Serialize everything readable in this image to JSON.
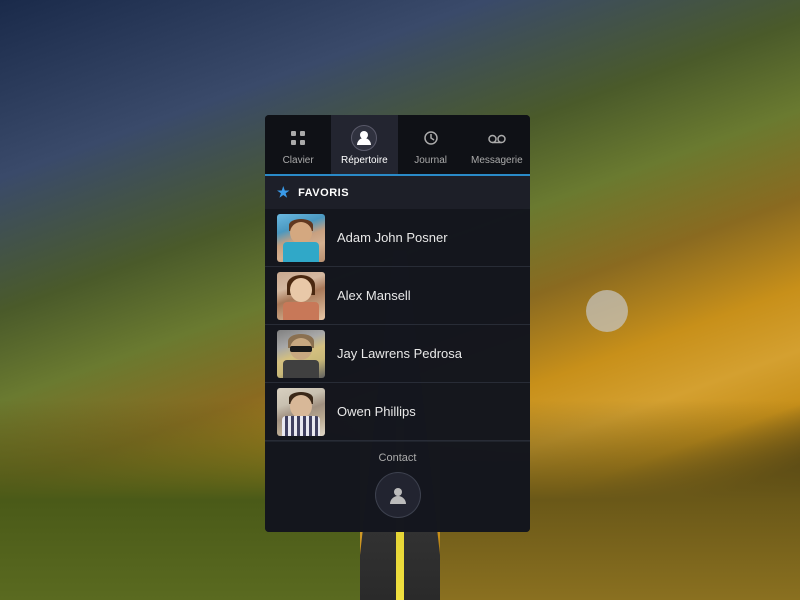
{
  "background": {
    "description": "Road through countryside at golden hour"
  },
  "tabs": [
    {
      "id": "clavier",
      "label": "Clavier",
      "icon": "grid",
      "active": false
    },
    {
      "id": "repertoire",
      "label": "Répertoire",
      "icon": "person",
      "active": true
    },
    {
      "id": "journal",
      "label": "Journal",
      "icon": "clock",
      "active": false
    },
    {
      "id": "messagerie",
      "label": "Messagerie",
      "icon": "voicemail",
      "active": false
    }
  ],
  "section": {
    "header": "FAVORIS"
  },
  "contacts": [
    {
      "id": 1,
      "name": "Adam John Posner",
      "avatar_class": "avatar-1"
    },
    {
      "id": 2,
      "name": "Alex Mansell",
      "avatar_class": "avatar-2"
    },
    {
      "id": 3,
      "name": "Jay Lawrens Pedrosa",
      "avatar_class": "avatar-3"
    },
    {
      "id": 4,
      "name": "Owen Phillips",
      "avatar_class": "avatar-4"
    }
  ],
  "footer": {
    "contact_label": "Contact",
    "contact_icon": "person"
  }
}
